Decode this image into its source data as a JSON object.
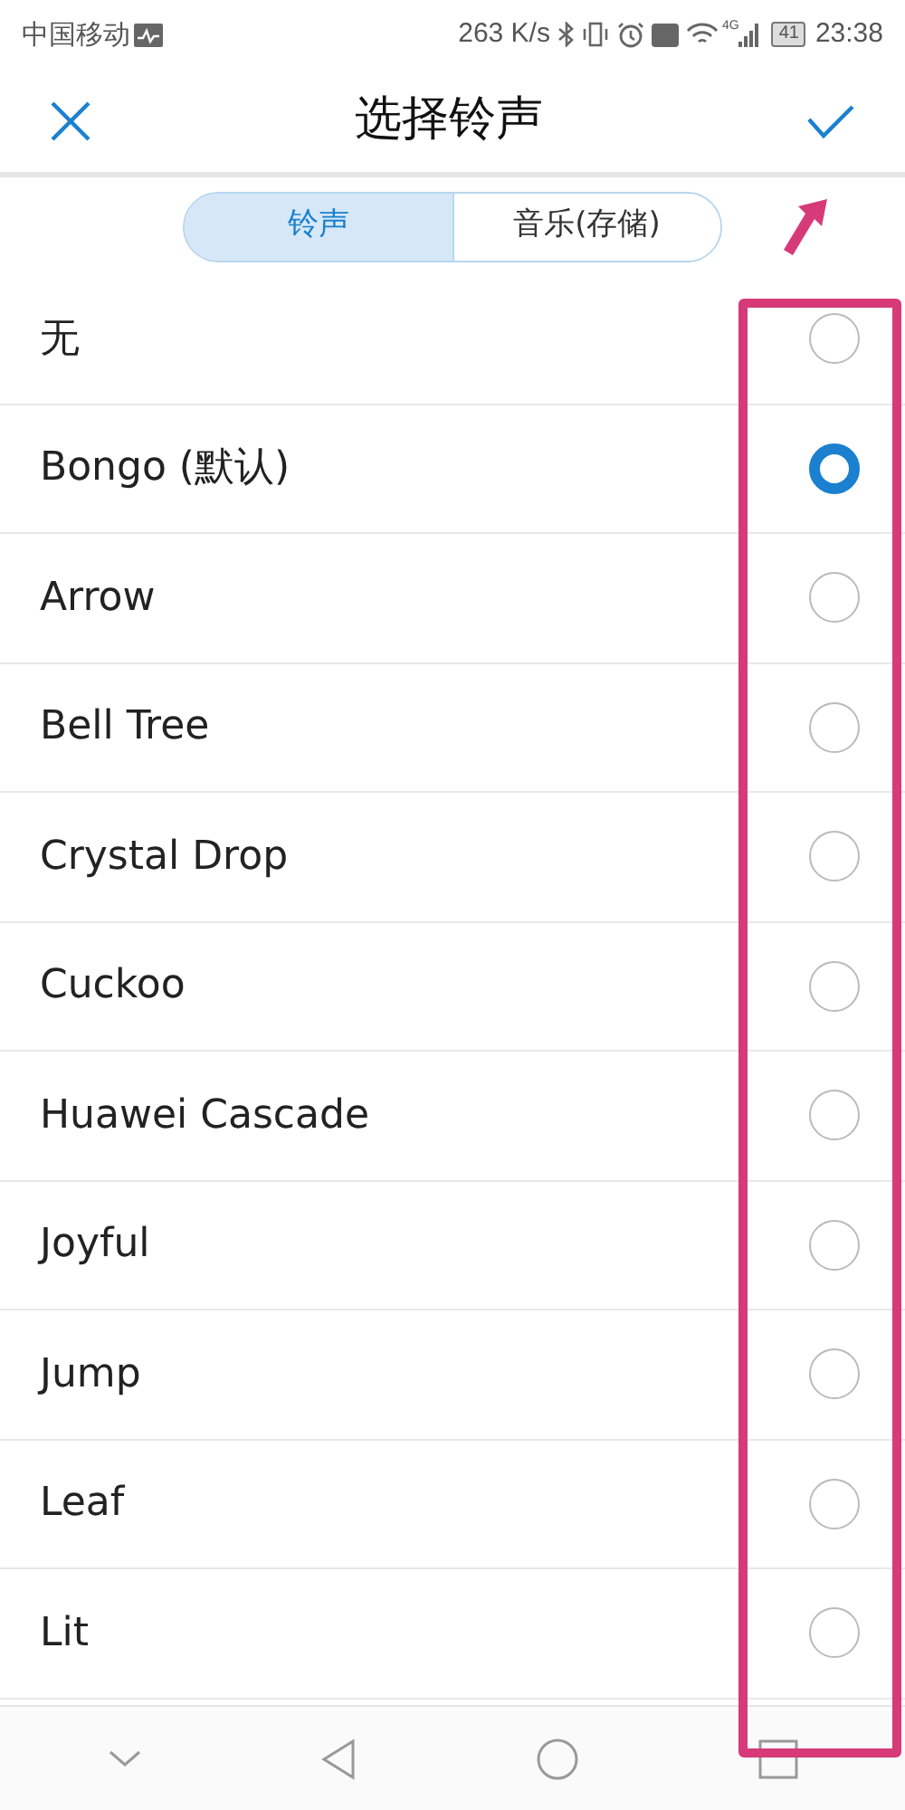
{
  "status_bar": {
    "carrier": "中国移动",
    "speed": "263 K/s",
    "network": "4G",
    "battery": "41",
    "time": "23:38"
  },
  "header": {
    "title": "选择铃声"
  },
  "tabs": [
    {
      "label": "铃声",
      "selected": true
    },
    {
      "label": "音乐(存储)",
      "selected": false
    }
  ],
  "ringtones": [
    {
      "label": "无",
      "selected": false
    },
    {
      "label": "Bongo (默认)",
      "selected": true
    },
    {
      "label": "Arrow",
      "selected": false
    },
    {
      "label": "Bell Tree",
      "selected": false
    },
    {
      "label": "Crystal Drop",
      "selected": false
    },
    {
      "label": "Cuckoo",
      "selected": false
    },
    {
      "label": "Huawei Cascade",
      "selected": false
    },
    {
      "label": "Joyful",
      "selected": false
    },
    {
      "label": "Jump",
      "selected": false
    },
    {
      "label": "Leaf",
      "selected": false
    },
    {
      "label": "Lit",
      "selected": false
    }
  ]
}
